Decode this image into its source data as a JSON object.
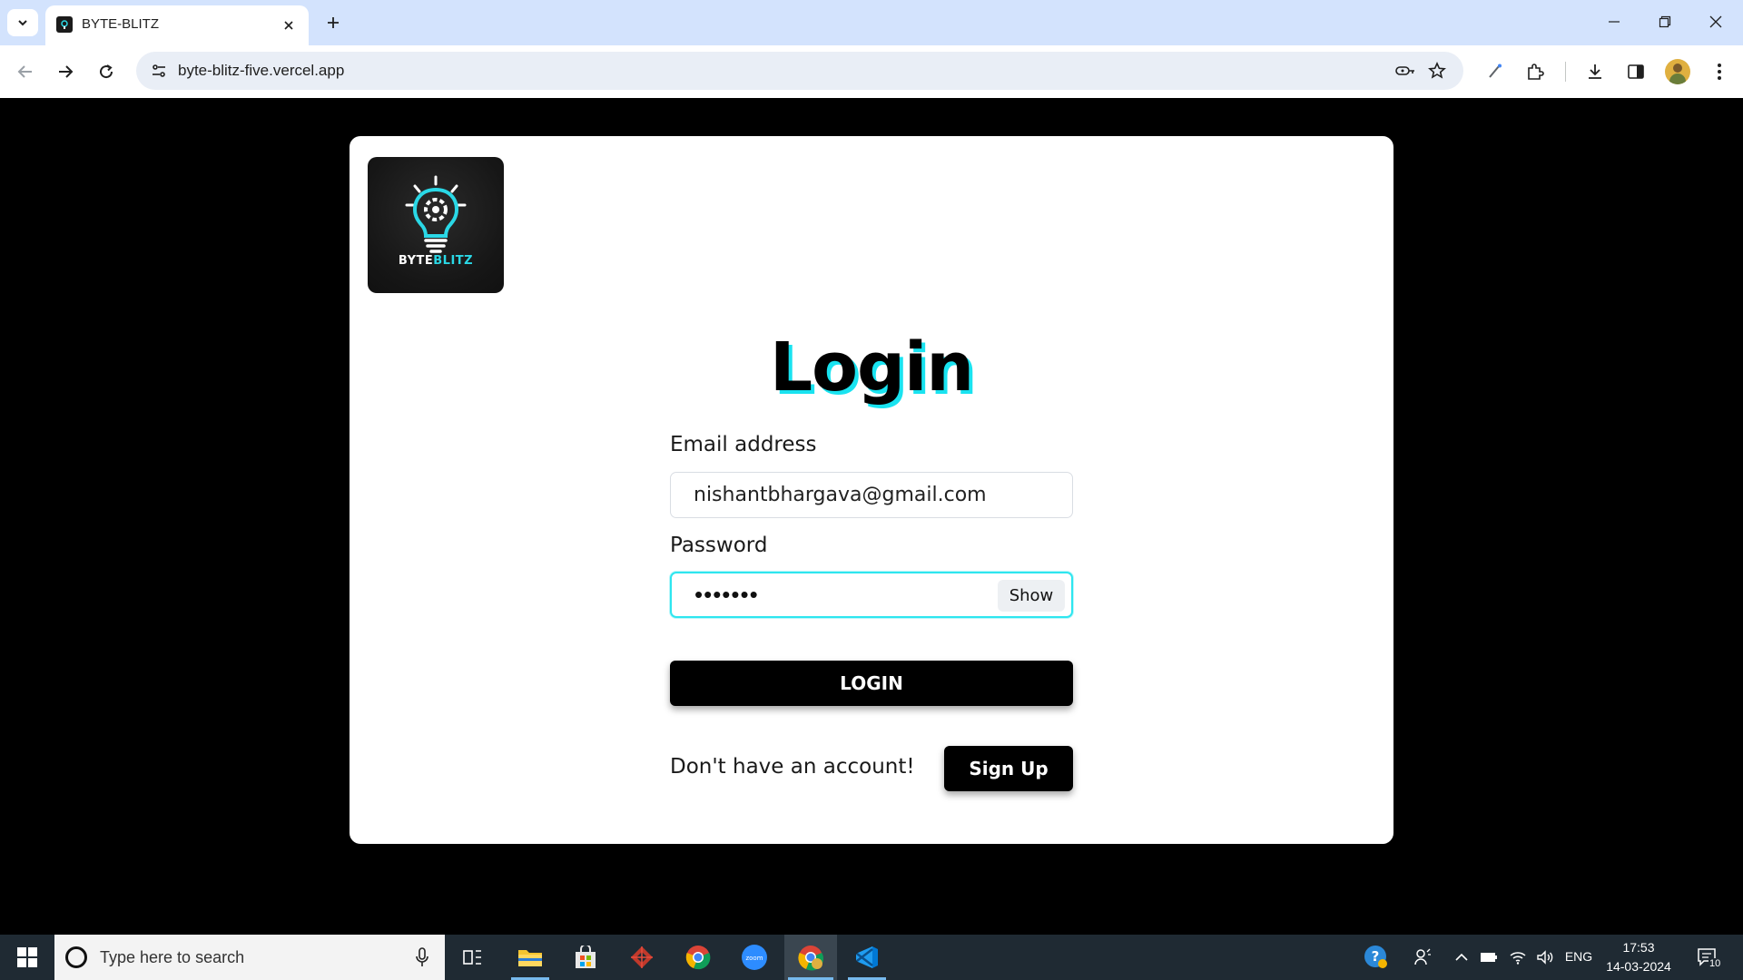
{
  "browser": {
    "tab_title": "BYTE-BLITZ",
    "url": "byte-blitz-five.vercel.app"
  },
  "page": {
    "logo": {
      "text_main": "BYTE",
      "text_accent": "BLITZ"
    },
    "title": "Login",
    "email": {
      "label": "Email address",
      "value": "nishantbhargava@gmail.com"
    },
    "password": {
      "label": "Password",
      "masked_value": "•••••••",
      "toggle_label": "Show"
    },
    "login_button": "LOGIN",
    "signup_prompt": "Don't have an account!",
    "signup_button": "Sign Up",
    "colors": {
      "accent": "#19e3f0",
      "button": "#000000",
      "background": "#000000"
    }
  },
  "taskbar": {
    "search_placeholder": "Type here to search",
    "language": "ENG",
    "time": "17:53",
    "date": "14-03-2024",
    "notifications_count": "10",
    "apps": [
      "task-view",
      "file-explorer",
      "microsoft-store",
      "app-red",
      "chrome",
      "zoom",
      "chrome-active",
      "vscode"
    ]
  }
}
